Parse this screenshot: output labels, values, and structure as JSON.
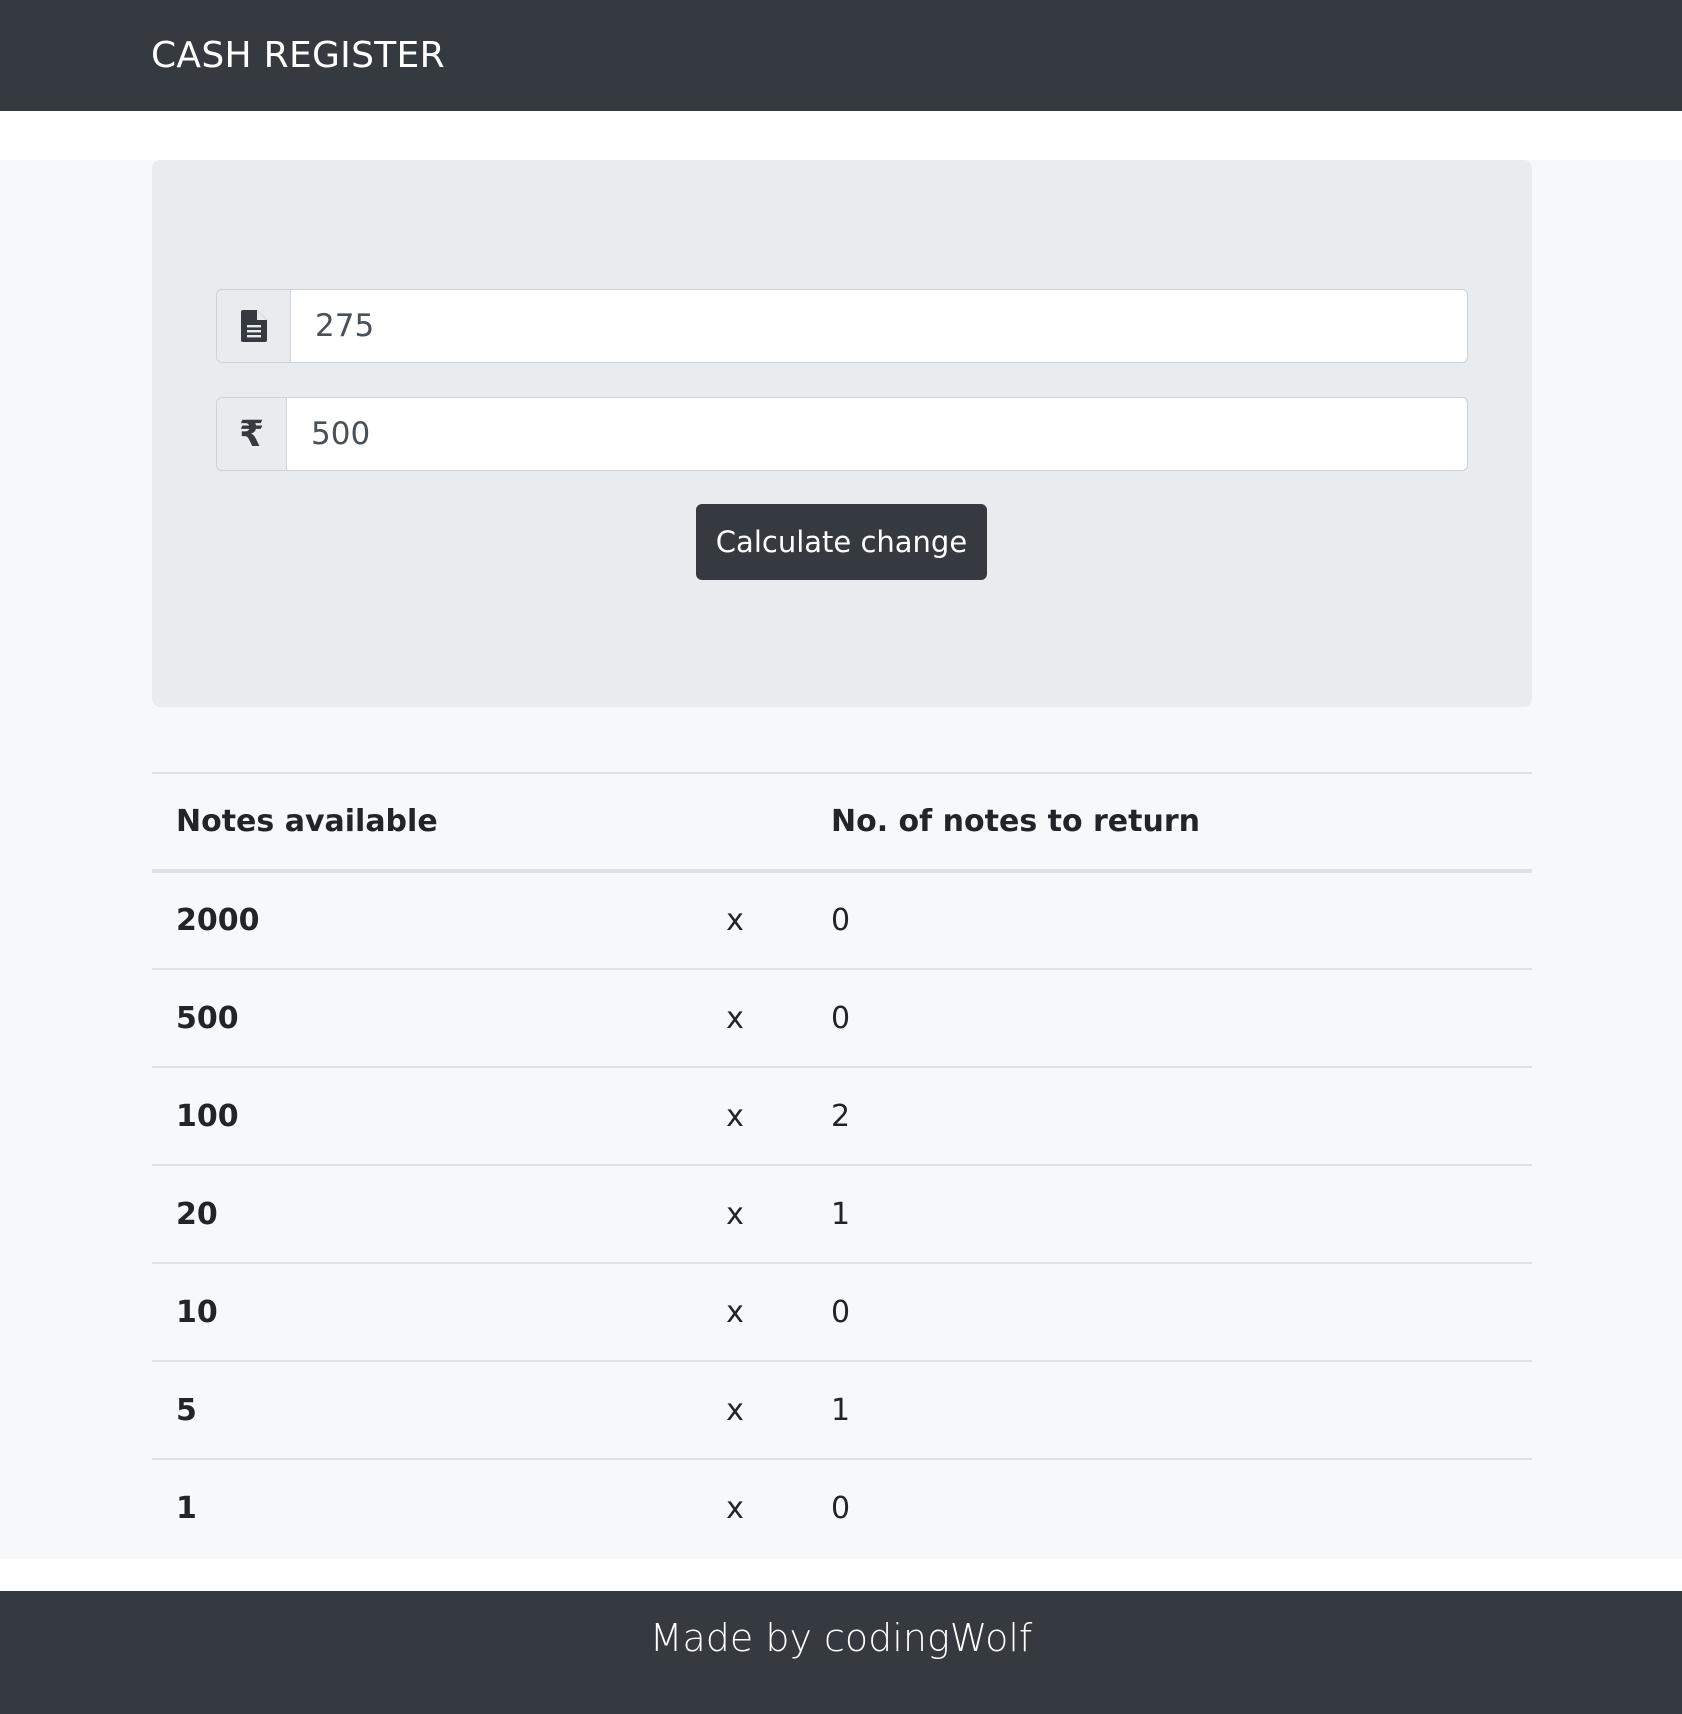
{
  "navbar": {
    "brand": "CASH REGISTER"
  },
  "form": {
    "bill_amount": {
      "value": "275",
      "icon": "file-text-icon"
    },
    "cash_given": {
      "value": "500",
      "icon": "rupee-icon",
      "symbol": "₹"
    },
    "calculate_label": "Calculate change"
  },
  "table": {
    "headers": [
      "Notes available",
      "",
      "No. of notes to return"
    ],
    "rows": [
      {
        "note": "2000",
        "times": "x",
        "count": "0"
      },
      {
        "note": "500",
        "times": "x",
        "count": "0"
      },
      {
        "note": "100",
        "times": "x",
        "count": "2"
      },
      {
        "note": "20",
        "times": "x",
        "count": "1"
      },
      {
        "note": "10",
        "times": "x",
        "count": "0"
      },
      {
        "note": "5",
        "times": "x",
        "count": "1"
      },
      {
        "note": "1",
        "times": "x",
        "count": "0"
      }
    ]
  },
  "footer": {
    "text": "Made by codingWolf"
  },
  "colors": {
    "navbar_bg": "#343a40",
    "jumbotron_bg": "#e9ecef",
    "page_bg": "#f7f8fa",
    "button_bg": "#343a40"
  }
}
